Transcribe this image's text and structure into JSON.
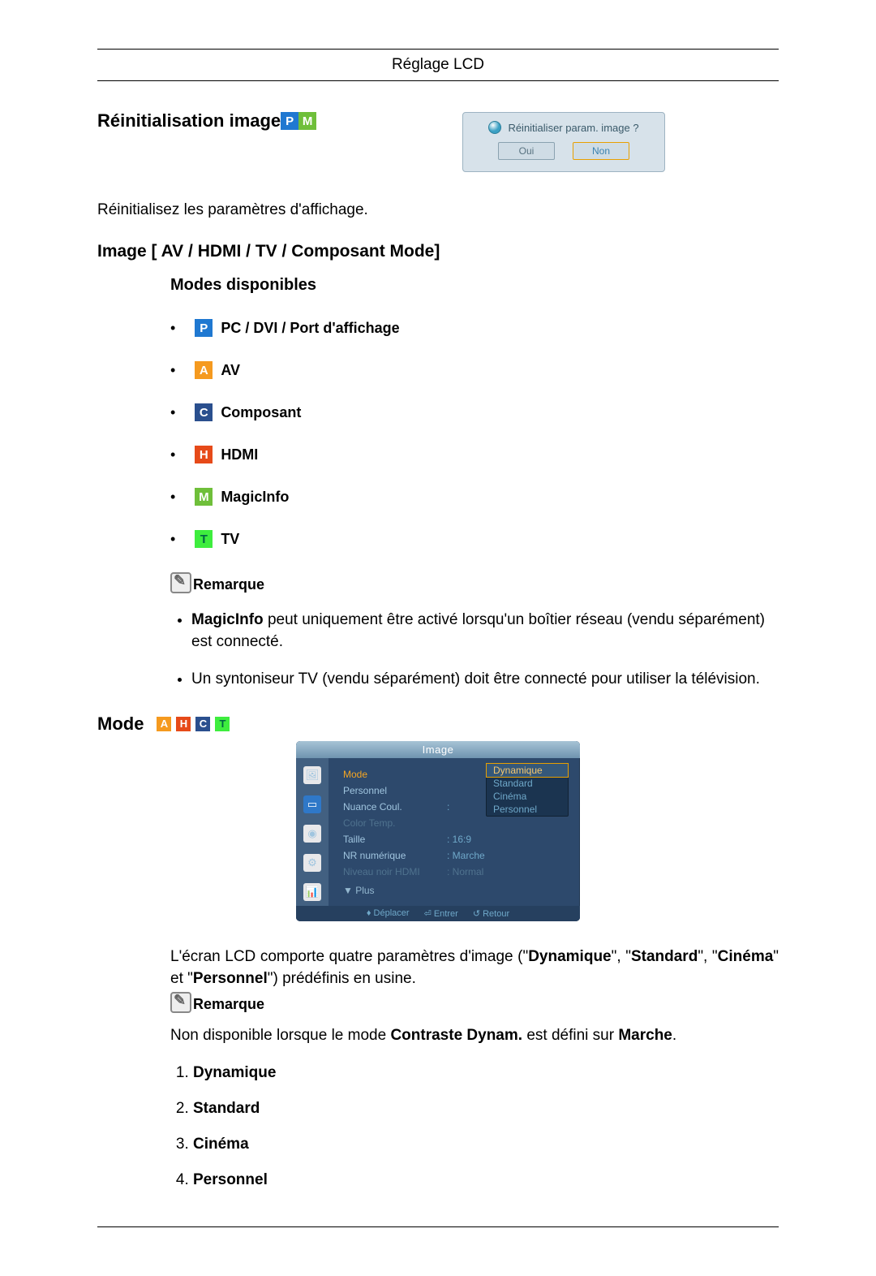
{
  "header": {
    "title": "Réglage LCD"
  },
  "reinit": {
    "title": "Réinitialisation image",
    "badges": [
      "P",
      "M"
    ],
    "dialog": {
      "question": "Réinitialiser param. image ?",
      "yes": "Oui",
      "no": "Non"
    },
    "desc": "Réinitialisez les paramètres d'affichage."
  },
  "image_section": {
    "title": "Image [ AV / HDMI / TV / Composant Mode]",
    "subtitle": "Modes disponibles",
    "modes": [
      {
        "badge": "P",
        "label": "PC / DVI / Port d'affichage"
      },
      {
        "badge": "A",
        "label": "AV"
      },
      {
        "badge": "C",
        "label": "Composant"
      },
      {
        "badge": "H",
        "label": "HDMI"
      },
      {
        "badge": "M",
        "label": "MagicInfo"
      },
      {
        "badge": "T",
        "label": "TV"
      }
    ],
    "remark_label": "Remarque",
    "remarks": [
      {
        "pre": "",
        "bold": "MagicInfo",
        "post": " peut uniquement être activé lorsqu'un boîtier réseau (vendu séparément) est connecté."
      },
      {
        "pre": "Un syntoniseur TV (vendu séparément) doit être connecté pour utiliser la télévision.",
        "bold": "",
        "post": ""
      }
    ]
  },
  "mode_section": {
    "title": "Mode",
    "badges": [
      "A",
      "H",
      "C",
      "T"
    ],
    "osd": {
      "title": "Image",
      "rows": {
        "mode_label": "Mode",
        "mode_value": "Dynamique",
        "personnel": "Personnel",
        "nuance": "Nuance Coul.",
        "color_temp": "Color Temp.",
        "taille_label": "Taille",
        "taille_value": "16:9",
        "nr_label": "NR numérique",
        "nr_value": "Marche",
        "hdmi_label": "Niveau noir HDMI",
        "hdmi_value": "Normal",
        "plus": "▼ Plus"
      },
      "options": [
        "Dynamique",
        "Standard",
        "Cinéma",
        "Personnel"
      ],
      "footer": {
        "move": "Déplacer",
        "enter": "Entrer",
        "return": "Retour"
      }
    },
    "para_pre": "L'écran LCD comporte quatre paramètres d'image (\"",
    "para_bold1": "Dynamique",
    "para_mid1": "\", \"",
    "para_bold2": "Standard",
    "para_mid2": "\", \"",
    "para_bold3": "Cinéma",
    "para_mid3": "\" et \"",
    "para_bold4": "Personnel",
    "para_post": "\") prédéfinis en usine.",
    "remark_label": "Remarque",
    "note_pre": "Non disponible lorsque le mode ",
    "note_bold1": "Contraste Dynam.",
    "note_mid": " est défini sur ",
    "note_bold2": "Marche",
    "note_post": ".",
    "list": [
      "Dynamique",
      "Standard",
      "Cinéma",
      "Personnel"
    ]
  }
}
